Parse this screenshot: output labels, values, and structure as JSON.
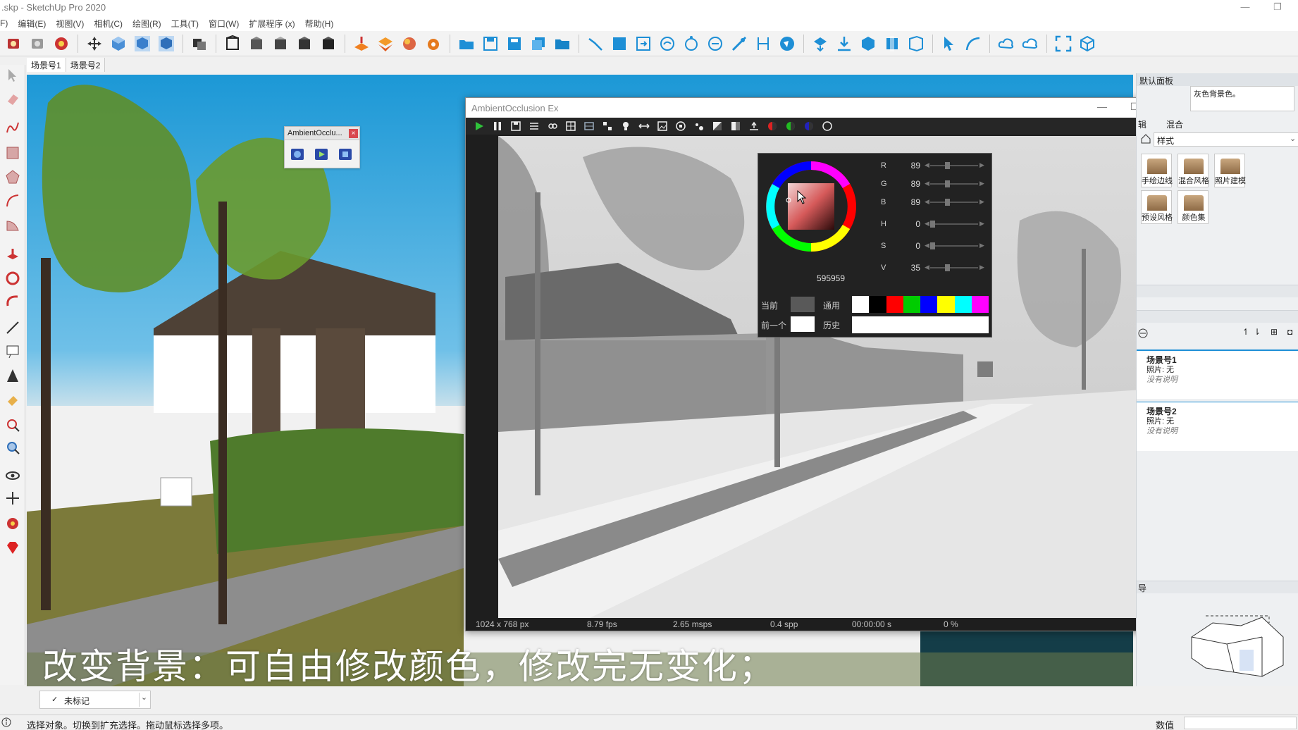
{
  "app": {
    "window_title": ".skp - SketchUp Pro 2020",
    "minimize": "—",
    "maximize": "❐"
  },
  "menu": [
    "F)",
    "编辑(E)",
    "视图(V)",
    "相机(C)",
    "绘图(R)",
    "工具(T)",
    "窗口(W)",
    "扩展程序 (x)",
    "帮助(H)"
  ],
  "scene_tabs": [
    "场景号1",
    "场景号2"
  ],
  "subtitle": "改变背景：可自由修改颜色，修改完无变化；",
  "ao_mini_toolbar": {
    "title": "AmbientOcclu...",
    "close": "×"
  },
  "ao_window": {
    "title": "AmbientOcclusion Ex",
    "minimize": "—",
    "maximize": "☐",
    "close": "✕",
    "status": {
      "resolution": "1024 x 768 px",
      "fps": "8.79 fps",
      "msps": "2.65 msps",
      "spp": "0.4 spp",
      "time": "00:00:00 s",
      "progress": "0 %"
    }
  },
  "color_picker": {
    "hex": "595959",
    "sliders": [
      {
        "label": "R",
        "value": "89",
        "level": 0.35
      },
      {
        "label": "G",
        "value": "89",
        "level": 0.35
      },
      {
        "label": "B",
        "value": "89",
        "level": 0.35
      },
      {
        "label": "H",
        "value": "0",
        "level": 0.0
      },
      {
        "label": "S",
        "value": "0",
        "level": 0.0
      },
      {
        "label": "V",
        "value": "35",
        "level": 0.35
      }
    ],
    "current_label": "当前",
    "common_label": "通用",
    "previous_label": "前一个",
    "history_label": "历史",
    "current_color": "#595959",
    "previous_color": "#ffffff",
    "common_colors": [
      "#ffffff",
      "#000000",
      "#ff0000",
      "#00cc00",
      "#0000ff",
      "#ffff00",
      "#00ffff",
      "#ff00ff"
    ]
  },
  "right_panel": {
    "tray_title": "默认面板",
    "style_desc": "灰色背景色。",
    "tab_edit": "辑",
    "tab_mix": "混合",
    "style_select": "样式",
    "style_thumbs": [
      "手绘边线",
      "混合风格",
      "照片建模",
      "预设风格",
      "颜色集"
    ],
    "scenes": [
      {
        "name": "场景号1",
        "photo": "照片: 无",
        "desc": "没有说明"
      },
      {
        "name": "场景号2",
        "photo": "照片: 无",
        "desc": "没有说明"
      }
    ],
    "nav_label": "导"
  },
  "tag_selector": {
    "value": "未标记"
  },
  "status": {
    "hint": "选择对象。切换到扩充选择。拖动鼠标选择多项。",
    "measure_label": "数值"
  }
}
